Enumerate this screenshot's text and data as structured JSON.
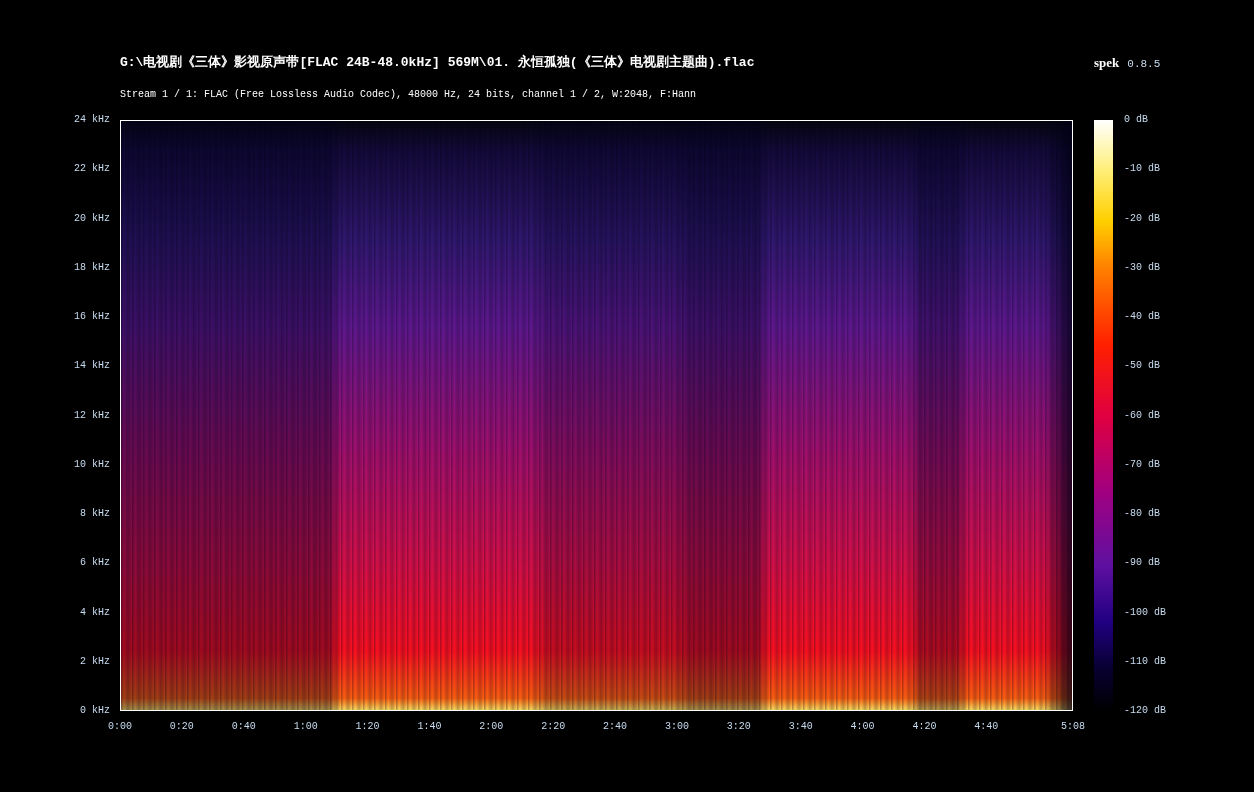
{
  "header": {
    "file_path": "G:\\电视剧《三体》影视原声带[FLAC 24B-48.0kHz] 569M\\01. 永恒孤独(《三体》电视剧主题曲).flac",
    "stream_info": "Stream 1 / 1: FLAC (Free Lossless Audio Codec), 48000 Hz, 24 bits, channel 1 / 2, W:2048, F:Hann",
    "app_name": "spek",
    "app_version": "0.8.5"
  },
  "frequency_axis": [
    "24 kHz",
    "22 kHz",
    "20 kHz",
    "18 kHz",
    "16 kHz",
    "14 kHz",
    "12 kHz",
    "10 kHz",
    "8 kHz",
    "6 kHz",
    "4 kHz",
    "2 kHz",
    "0 kHz"
  ],
  "time_axis": [
    "0:00",
    "0:20",
    "0:40",
    "1:00",
    "1:20",
    "1:40",
    "2:00",
    "2:20",
    "2:40",
    "3:00",
    "3:20",
    "3:40",
    "4:00",
    "4:20",
    "4:40",
    "5:08"
  ],
  "color_scale": [
    "0 dB",
    "-10 dB",
    "-20 dB",
    "-30 dB",
    "-40 dB",
    "-50 dB",
    "-60 dB",
    "-70 dB",
    "-80 dB",
    "-90 dB",
    "-100 dB",
    "-110 dB",
    "-120 dB"
  ]
}
